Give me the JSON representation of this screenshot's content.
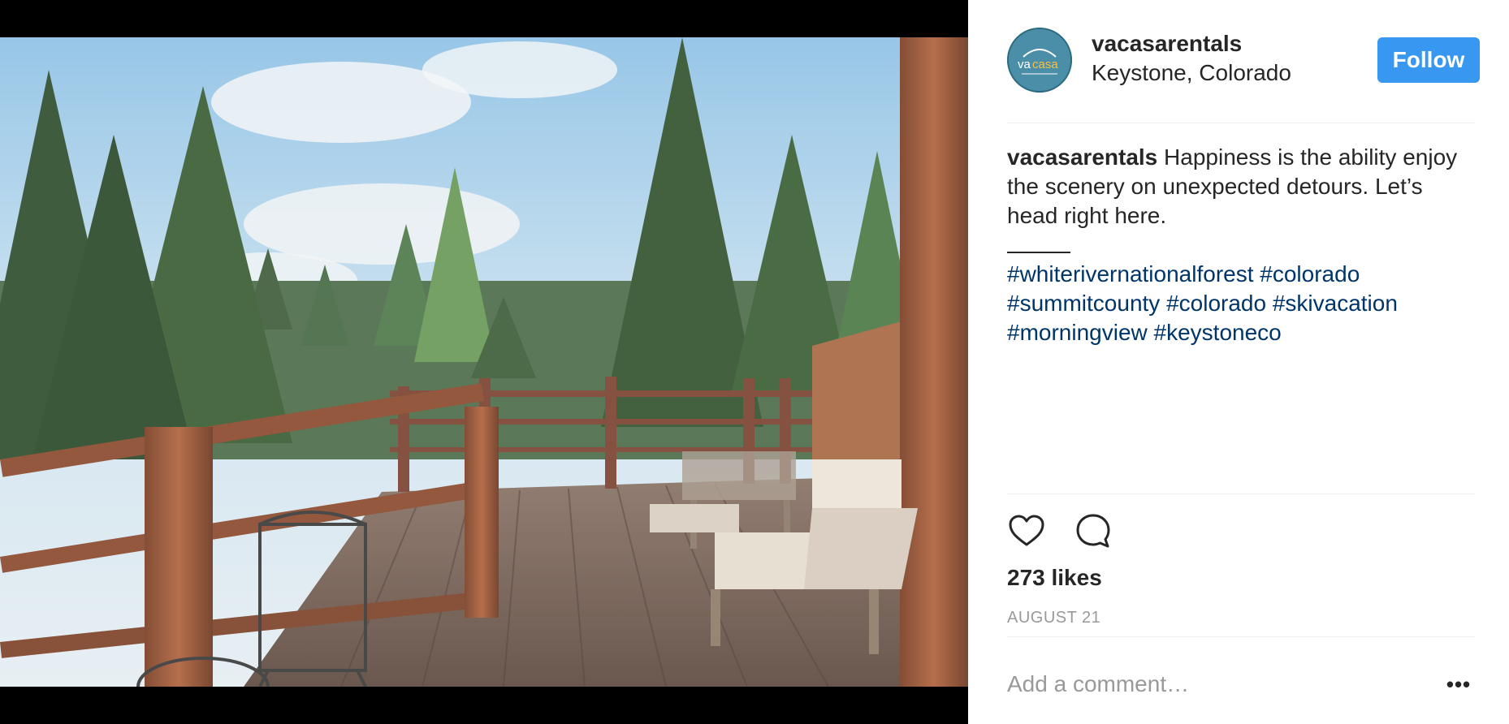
{
  "post": {
    "author": "vacasarentals",
    "location": "Keystone, Colorado",
    "follow_label": "Follow",
    "caption_author": "vacasarentals",
    "caption_text": "Happiness is the ability enjoy the scenery on unexpected detours. Let’s head right here.",
    "hashtags": [
      "#whiterivernationalforest",
      "#colorado",
      "#summitcounty",
      "#colorado",
      "#skivacation",
      "#morningview",
      "#keystoneco"
    ],
    "likes": "273 likes",
    "date": "AUGUST 21",
    "comment_placeholder": "Add a comment…",
    "more_label": "•••"
  },
  "avatar": {
    "logo_text_1": "va",
    "logo_text_2": "casa"
  },
  "icons": {
    "like": "heart-icon",
    "comment": "speech-bubble-icon",
    "more": "ellipsis-icon"
  },
  "colors": {
    "accent": "#3897f0",
    "hashtag": "#003569",
    "muted": "#999999",
    "avatar_bg": "#4a8fa7"
  }
}
